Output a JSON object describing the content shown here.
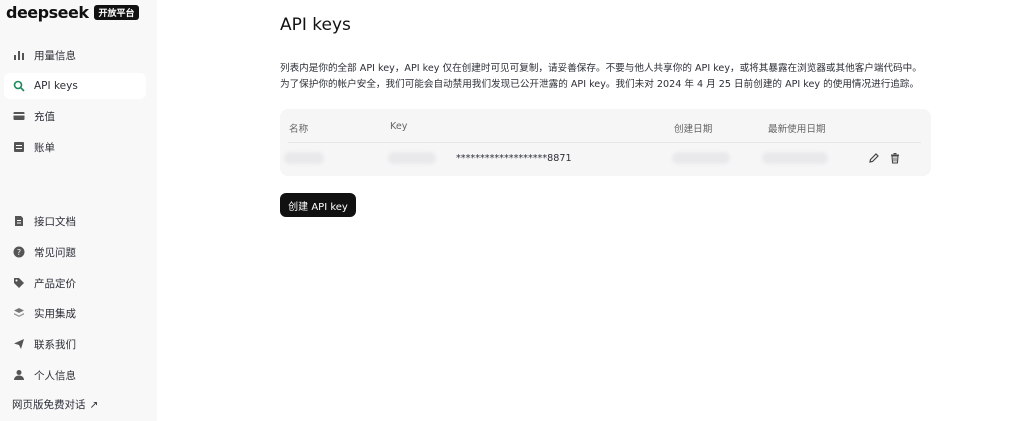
{
  "brand": {
    "name": "deepseek",
    "badge": "开放平台"
  },
  "sidebar": {
    "items": [
      {
        "label": "用量信息",
        "icon": "bar-chart-icon"
      },
      {
        "label": "API keys",
        "icon": "search-icon",
        "active": true
      },
      {
        "label": "充值",
        "icon": "credit-card-icon"
      },
      {
        "label": "账单",
        "icon": "bill-icon"
      },
      {
        "label": "接口文档",
        "icon": "document-icon"
      },
      {
        "label": "常见问题",
        "icon": "question-icon"
      },
      {
        "label": "产品定价",
        "icon": "tag-icon"
      },
      {
        "label": "实用集成",
        "icon": "layers-icon"
      },
      {
        "label": "联系我们",
        "icon": "send-icon"
      },
      {
        "label": "个人信息",
        "icon": "user-icon"
      }
    ],
    "web_link": "网页版免费对话",
    "web_link_arrow": "↗"
  },
  "main": {
    "title": "API keys",
    "description_line1": "列表内是你的全部 API key，API key 仅在创建时可见可复制，请妥善保存。不要与他人共享你的 API key，或将其暴露在浏览器或其他客户端代码中。",
    "description_line2": "为了保护你的帐户安全，我们可能会自动禁用我们发现已公开泄露的 API key。我们未对 2024 年 4 月 25 日前创建的 API key 的使用情况进行追踪。",
    "table": {
      "headers": {
        "name": "名称",
        "key": "Key",
        "created": "创建日期",
        "last_used": "最新使用日期"
      },
      "rows": [
        {
          "key_masked": "*******************8871"
        }
      ]
    },
    "create_button": "创建 API key"
  }
}
